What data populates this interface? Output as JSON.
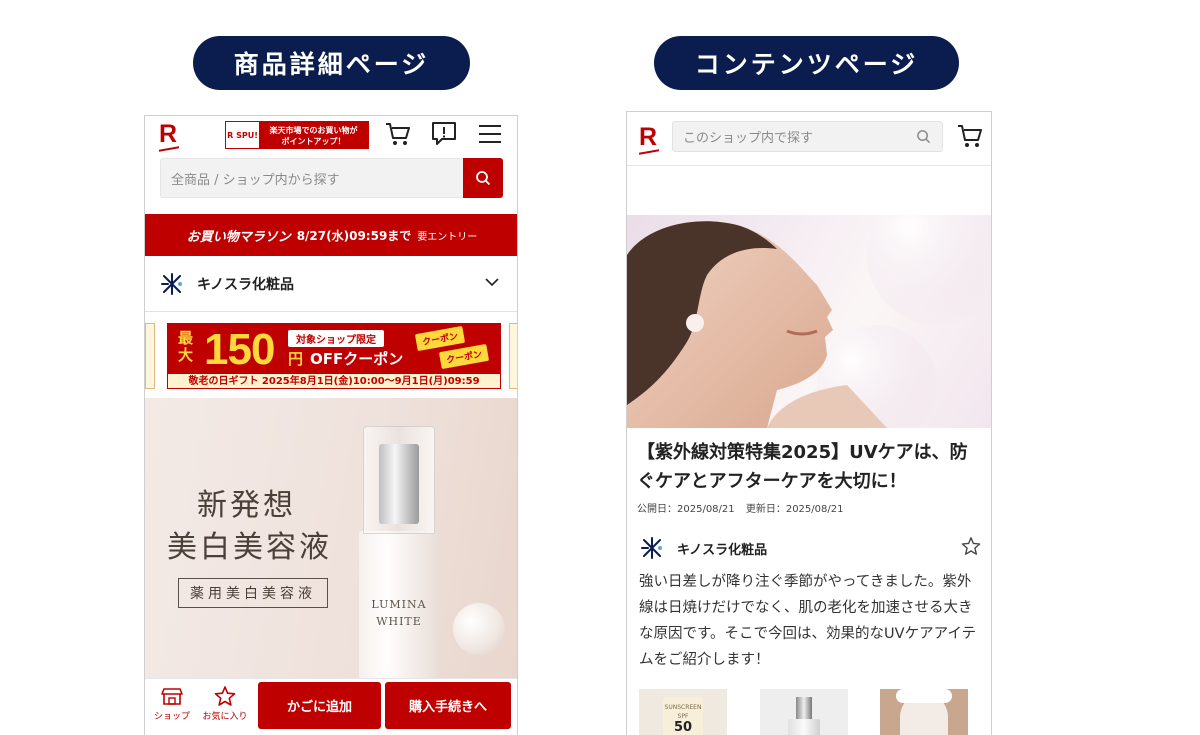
{
  "labels": {
    "left_title": "商品詳細ページ",
    "right_title": "コンテンツページ"
  },
  "product_page": {
    "logo": "R",
    "spu_banner": {
      "logo": "R SPU!",
      "text_line1": "楽天市場でのお買い物が",
      "text_line2": "ポイントアップ！"
    },
    "search_placeholder": "全商品 / ショップ内から探す",
    "marathon_banner": {
      "title": "お買い物マラソン",
      "date": "8/27(水)09:59まで",
      "entry": "要エントリー"
    },
    "shop_name": "キノスラ化粧品",
    "coupon": {
      "max_label": "最大",
      "amount": "150",
      "yen": "円",
      "off_label": "OFFクーポン",
      "limited": "対象ショップ限定",
      "tag": "クーポン",
      "campaign": "敬老の日ギフト 2025年8月1日(金)10:00〜9月1日(月)09:59"
    },
    "hero": {
      "headline_line1": "新発想",
      "headline_line2": "美白美容液",
      "badge": "薬用美白美容液",
      "bottle_brand_line1": "LUMINA",
      "bottle_brand_line2": "WHITE"
    },
    "actions": {
      "shop_label": "ショップ",
      "favorite_label": "お気に入り",
      "add_to_cart": "かごに追加",
      "checkout": "購入手続きへ"
    },
    "icons": [
      "cart-icon",
      "notification-icon",
      "menu-icon",
      "search-icon",
      "chevron-down-icon",
      "shop-icon",
      "star-icon"
    ],
    "accent_color": "#bf0000"
  },
  "content_page": {
    "logo": "R",
    "search_placeholder": "このショップ内で探す",
    "article": {
      "title": "【紫外線対策特集2025】UVケアは、防ぐケアとアフターケアを大切に！",
      "published": "公開日：2025/08/21",
      "updated": "更新日：2025/08/21",
      "author": "キノスラ化粧品",
      "body": "強い日差しが降り注ぐ季節がやってきました。紫外線は日焼けだけでなく、肌の老化を加速させる大きな原因です。そこで今回は、効果的なUVケアアイテムをご紹介します！"
    },
    "thumbnails": [
      {
        "label_line1": "SUNSCREEN",
        "label_line2": "SPF",
        "label_line3": "50"
      },
      {
        "label": ""
      },
      {
        "label": ""
      }
    ],
    "icons": [
      "search-icon",
      "cart-icon",
      "star-outline-icon"
    ]
  },
  "colors": {
    "pill_bg": "#0b1d4f",
    "brand_red": "#bf0000"
  }
}
